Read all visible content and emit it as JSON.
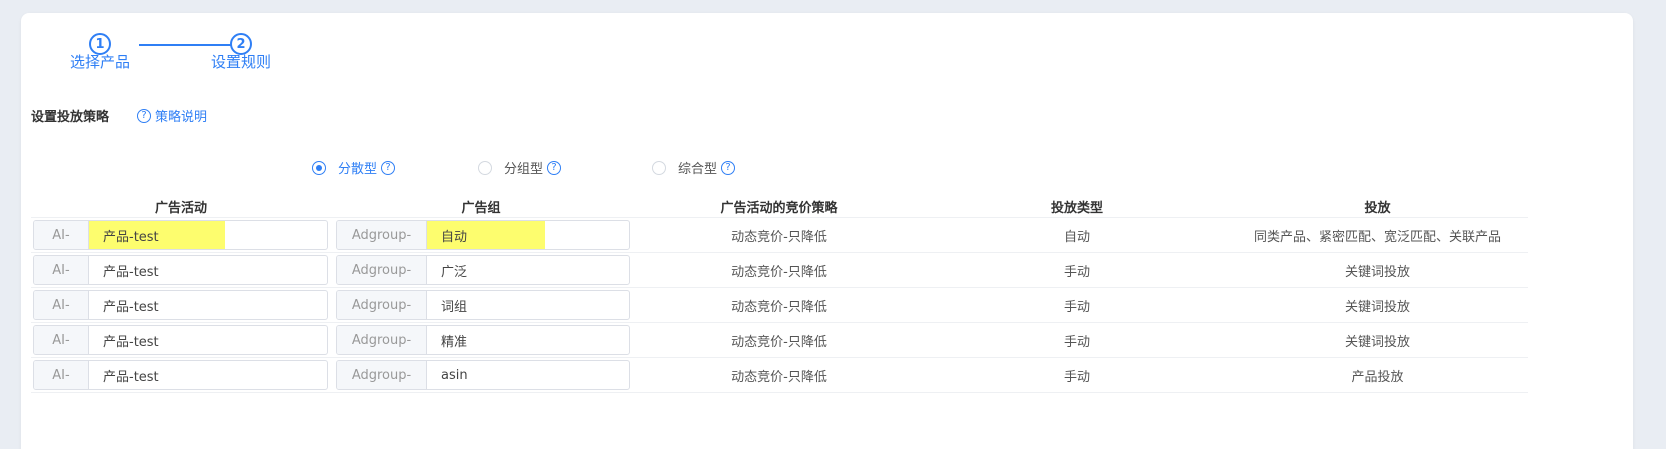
{
  "steps": [
    {
      "number": "1",
      "label": "选择产品"
    },
    {
      "number": "2",
      "label": "设置规则"
    }
  ],
  "strategy": {
    "title": "设置投放策略",
    "help_label": "策略说明",
    "help_icon": "question-circle-icon",
    "options": [
      {
        "label": "分散型",
        "selected": true
      },
      {
        "label": "分组型",
        "selected": false
      },
      {
        "label": "综合型",
        "selected": false
      }
    ]
  },
  "table": {
    "headers": [
      "广告活动",
      "广告组",
      "广告活动的竞价策略",
      "投放类型",
      "投放"
    ],
    "rows": [
      {
        "campaign_prefix": "AI-",
        "campaign_name": "产品-test",
        "adgroup_prefix": "Adgroup-",
        "adgroup_name": "自动",
        "bid_strategy": "动态竞价-只降低",
        "targeting_type": "自动",
        "targeting": "同类产品、紧密匹配、宽泛匹配、关联产品"
      },
      {
        "campaign_prefix": "AI-",
        "campaign_name": "产品-test",
        "adgroup_prefix": "Adgroup-",
        "adgroup_name": "广泛",
        "bid_strategy": "动态竞价-只降低",
        "targeting_type": "手动",
        "targeting": "关键词投放"
      },
      {
        "campaign_prefix": "AI-",
        "campaign_name": "产品-test",
        "adgroup_prefix": "Adgroup-",
        "adgroup_name": "词组",
        "bid_strategy": "动态竞价-只降低",
        "targeting_type": "手动",
        "targeting": "关键词投放"
      },
      {
        "campaign_prefix": "AI-",
        "campaign_name": "产品-test",
        "adgroup_prefix": "Adgroup-",
        "adgroup_name": "精准",
        "bid_strategy": "动态竞价-只降低",
        "targeting_type": "手动",
        "targeting": "关键词投放"
      },
      {
        "campaign_prefix": "AI-",
        "campaign_name": "产品-test",
        "adgroup_prefix": "Adgroup-",
        "adgroup_name": "asin",
        "bid_strategy": "动态竞价-只降低",
        "targeting_type": "手动",
        "targeting": "产品投放"
      }
    ]
  },
  "colors": {
    "accent": "#2f7ff5",
    "highlight": "#fdfd6e"
  }
}
